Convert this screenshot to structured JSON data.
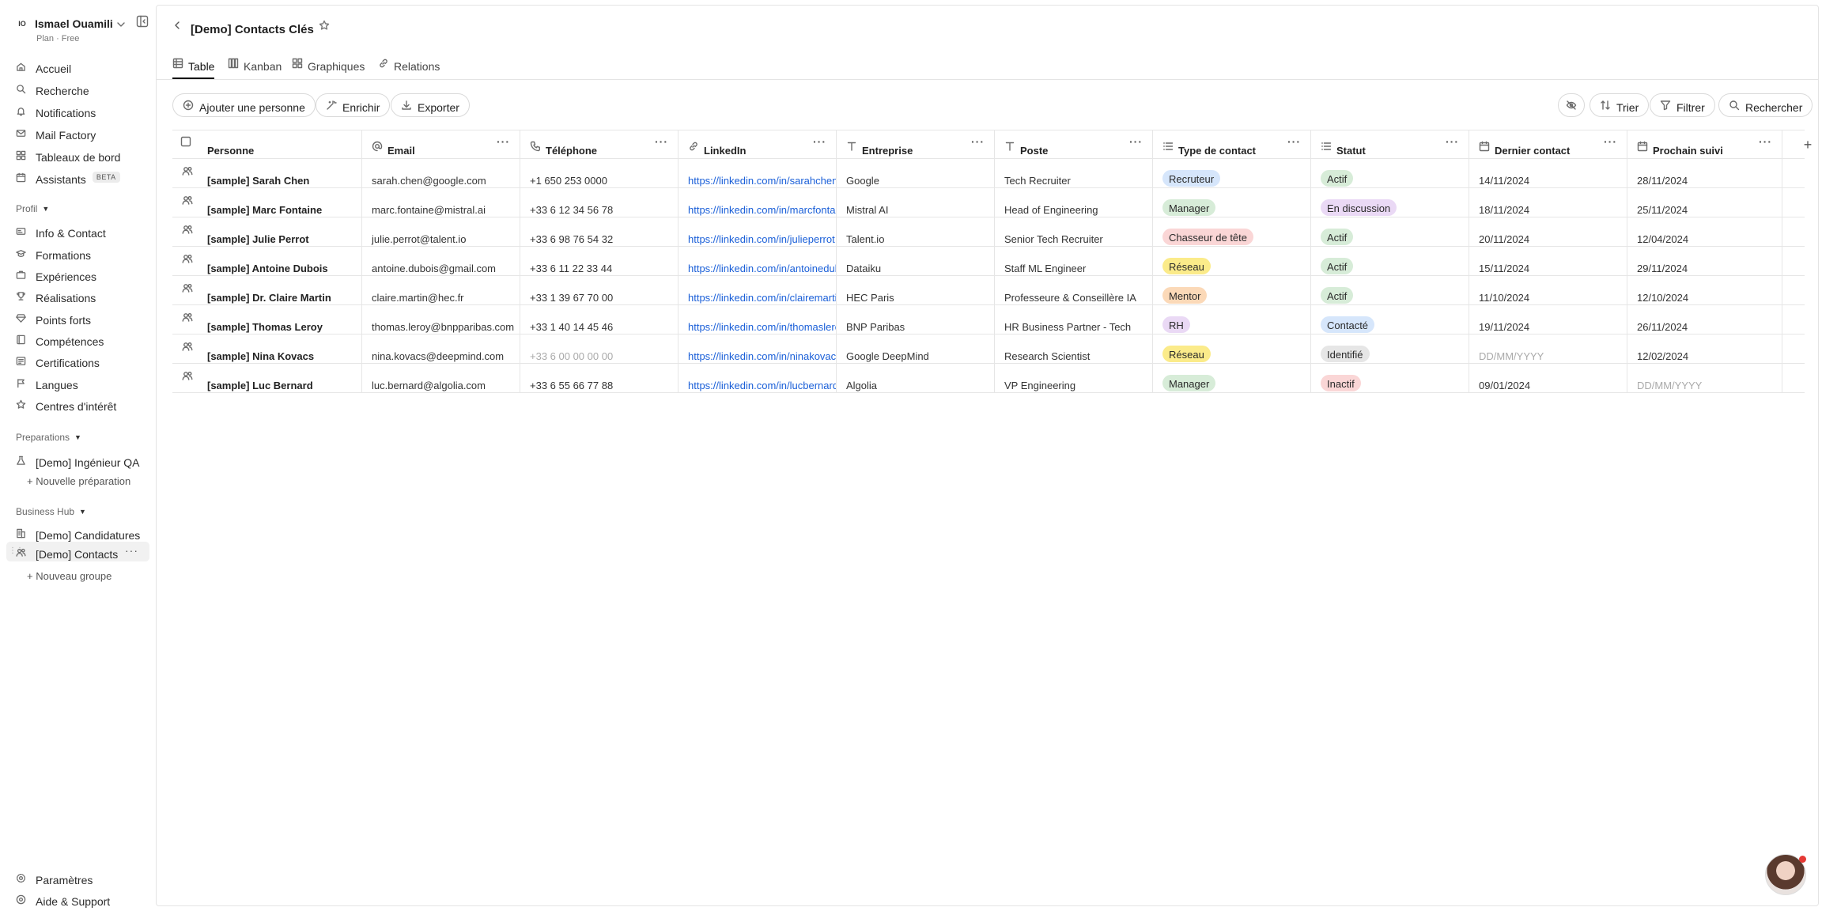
{
  "workspace": {
    "initials": "IO",
    "name": "Ismael Ouamili",
    "plan": "Plan · Free"
  },
  "nav": {
    "items": [
      {
        "label": "Accueil",
        "icon": "home-icon"
      },
      {
        "label": "Recherche",
        "icon": "search-icon"
      },
      {
        "label": "Notifications",
        "icon": "bell-icon"
      },
      {
        "label": "Mail Factory",
        "icon": "mail-icon"
      },
      {
        "label": "Tableaux de bord",
        "icon": "dashboard-icon"
      },
      {
        "label": "Assistants",
        "icon": "calendar-icon",
        "badge": "BETA"
      }
    ],
    "profil_label": "Profil",
    "profil_items": [
      {
        "label": "Info & Contact",
        "icon": "id-card-icon"
      },
      {
        "label": "Formations",
        "icon": "graduation-icon"
      },
      {
        "label": "Expériences",
        "icon": "briefcase-icon"
      },
      {
        "label": "Réalisations",
        "icon": "trophy-icon"
      },
      {
        "label": "Points forts",
        "icon": "gem-icon"
      },
      {
        "label": "Compétences",
        "icon": "book-icon"
      },
      {
        "label": "Certifications",
        "icon": "certificate-icon"
      },
      {
        "label": "Langues",
        "icon": "flag-icon"
      },
      {
        "label": "Centres d'intérêt",
        "icon": "star-icon"
      }
    ],
    "preparations_label": "Preparations",
    "preparations_items": [
      {
        "label": "[Demo] Ingénieur QA",
        "icon": "flask-icon"
      }
    ],
    "new_preparation": "+ Nouvelle préparation",
    "business_label": "Business Hub",
    "business_items": [
      {
        "label": "[Demo] Candidatures",
        "icon": "building-icon"
      },
      {
        "label": "[Demo] Contacts",
        "icon": "users-icon"
      }
    ],
    "new_group": "+ Nouveau groupe",
    "settings": "Paramètres",
    "help": "Aide & Support"
  },
  "page": {
    "title": "[Demo] Contacts Clés"
  },
  "tabs": [
    {
      "label": "Table",
      "icon": "table-icon"
    },
    {
      "label": "Kanban",
      "icon": "kanban-icon"
    },
    {
      "label": "Graphiques",
      "icon": "grid-icon"
    },
    {
      "label": "Relations",
      "icon": "link-icon"
    }
  ],
  "toolbar": {
    "add": "Ajouter une personne",
    "enrich": "Enrichir",
    "export": "Exporter",
    "sort": "Trier",
    "filter": "Filtrer",
    "search": "Rechercher"
  },
  "columns": [
    {
      "label": "Personne",
      "icon": "checkbox-icon"
    },
    {
      "label": "Email",
      "icon": "at-icon"
    },
    {
      "label": "Téléphone",
      "icon": "phone-icon"
    },
    {
      "label": "LinkedIn",
      "icon": "link-icon"
    },
    {
      "label": "Entreprise",
      "icon": "text-icon"
    },
    {
      "label": "Poste",
      "icon": "text-icon"
    },
    {
      "label": "Type de contact",
      "icon": "list-icon"
    },
    {
      "label": "Statut",
      "icon": "list-icon"
    },
    {
      "label": "Dernier contact",
      "icon": "calendar-icon"
    },
    {
      "label": "Prochain suivi",
      "icon": "calendar-icon"
    }
  ],
  "rows": [
    {
      "name": "[sample] Sarah Chen",
      "email": "sarah.chen@google.com",
      "phone": "+1 650 253 0000",
      "linkedin": "https://linkedin.com/in/sarahchen",
      "company": "Google",
      "role": "Tech Recruiter",
      "type": "Recruteur",
      "type_color": "#d6e6fb",
      "status": "Actif",
      "status_color": "#d7ecd8",
      "last": "14/11/2024",
      "next": "28/11/2024"
    },
    {
      "name": "[sample] Marc Fontaine",
      "email": "marc.fontaine@mistral.ai",
      "phone": "+33 6 12 34 56 78",
      "linkedin": "https://linkedin.com/in/marcfontaine",
      "company": "Mistral AI",
      "role": "Head of Engineering",
      "type": "Manager",
      "type_color": "#d7ecd8",
      "status": "En discussion",
      "status_color": "#ead9f5",
      "last": "18/11/2024",
      "next": "25/11/2024"
    },
    {
      "name": "[sample] Julie Perrot",
      "email": "julie.perrot@talent.io",
      "phone": "+33 6 98 76 54 32",
      "linkedin": "https://linkedin.com/in/julieperrot",
      "company": "Talent.io",
      "role": "Senior Tech Recruiter",
      "type": "Chasseur de tête",
      "type_color": "#fad6d6",
      "status": "Actif",
      "status_color": "#d7ecd8",
      "last": "20/11/2024",
      "next": "12/04/2024"
    },
    {
      "name": "[sample] Antoine Dubois",
      "email": "antoine.dubois@gmail.com",
      "phone": "+33 6 11 22 33 44",
      "linkedin": "https://linkedin.com/in/antoinedubois",
      "company": "Dataiku",
      "role": "Staff ML Engineer",
      "type": "Réseau",
      "type_color": "#fbeb8a",
      "status": "Actif",
      "status_color": "#d7ecd8",
      "last": "15/11/2024",
      "next": "29/11/2024"
    },
    {
      "name": "[sample] Dr. Claire Martin",
      "email": "claire.martin@hec.fr",
      "phone": "+33 1 39 67 70 00",
      "linkedin": "https://linkedin.com/in/clairemartin",
      "company": "HEC Paris",
      "role": "Professeure & Conseillère IA",
      "type": "Mentor",
      "type_color": "#fbd9b8",
      "status": "Actif",
      "status_color": "#d7ecd8",
      "last": "11/10/2024",
      "next": "12/10/2024"
    },
    {
      "name": "[sample] Thomas Leroy",
      "email": "thomas.leroy@bnpparibas.com",
      "phone": "+33 1 40 14 45 46",
      "linkedin": "https://linkedin.com/in/thomasleroy",
      "company": "BNP Paribas",
      "role": "HR Business Partner - Tech",
      "type": "RH",
      "type_color": "#ead9f5",
      "status": "Contacté",
      "status_color": "#d6e6fb",
      "last": "19/11/2024",
      "next": "26/11/2024"
    },
    {
      "name": "[sample] Nina Kovacs",
      "email": "nina.kovacs@deepmind.com",
      "phone": "+33 6 00 00 00 00",
      "phone_muted": true,
      "linkedin": "https://linkedin.com/in/ninakovacs",
      "company": "Google DeepMind",
      "role": "Research Scientist",
      "type": "Réseau",
      "type_color": "#fbeb8a",
      "status": "Identifié",
      "status_color": "#e6e6e6",
      "last": "DD/MM/YYYY",
      "last_muted": true,
      "next": "12/02/2024"
    },
    {
      "name": "[sample] Luc Bernard",
      "email": "luc.bernard@algolia.com",
      "phone": "+33 6 55 66 77 88",
      "linkedin": "https://linkedin.com/in/lucbernard",
      "company": "Algolia",
      "role": "VP Engineering",
      "type": "Manager",
      "type_color": "#d7ecd8",
      "status": "Inactif",
      "status_color": "#fad6d6",
      "last": "09/01/2024",
      "next": "DD/MM/YYYY",
      "next_muted": true
    }
  ]
}
